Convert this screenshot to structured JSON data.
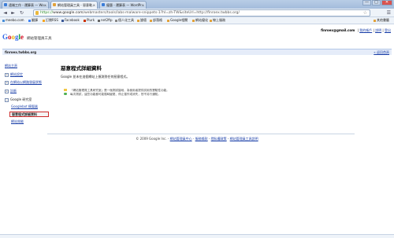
{
  "tabs": [
    {
      "label": "遠端工作 - 運算表 — Wo...",
      "active": false,
      "favicon_color": "#3b7dd8"
    },
    {
      "label": "網站管理員工具 - 惡意軟...",
      "active": true,
      "favicon_color": "#e2a23b"
    },
    {
      "label": "優惠 - 運算表 — WordPr...",
      "active": false,
      "favicon_color": "#3b7dd8"
    }
  ],
  "window": {
    "minimize": "—",
    "maximize": "□",
    "close": "✕"
  },
  "toolbar": {
    "back": "◄",
    "forward": "►",
    "reload": "↻",
    "url_scheme": "https://",
    "url_host": "www.google.com",
    "url_path": "/webmasters/tools/labs-malware-snippets-1?hl=zh-TW&siteUrl=http://finroex.twbbs.org/",
    "star": "☆",
    "menu": "☰"
  },
  "bookmarks": [
    {
      "label": "meebo.com",
      "icon_color": "#4a90d9"
    },
    {
      "label": "翻譯",
      "icon_color": "#4285f4"
    },
    {
      "label": "訂閱RSS",
      "icon_color": "#f5a623"
    },
    {
      "label": "Facebook",
      "icon_color": "#3b5998"
    },
    {
      "label": "Plurk",
      "icon_color": "#cc3300"
    },
    {
      "label": "net2ftp",
      "icon_color": "#666666"
    },
    {
      "label": "個人化工具",
      "icon_color": "#888888"
    },
    {
      "label": "論壇",
      "icon_color": "#e2a23b"
    },
    {
      "label": "部落格",
      "icon_color": "#e2a23b"
    },
    {
      "label": "Google相關",
      "icon_color": "#e2a23b"
    },
    {
      "label": "網站優化",
      "icon_color": "#e2a23b"
    },
    {
      "label": "線上服務",
      "icon_color": "#e2a23b"
    },
    {
      "label": "其他書籤",
      "icon_color": "#e2a23b"
    }
  ],
  "header": {
    "logo": [
      "G",
      "o",
      "o",
      "g",
      "l",
      "e"
    ],
    "product": "網站管理員工具",
    "email": "finroex@gmail.com",
    "sep1": "|",
    "my_account": "我的帳戶",
    "sep2": "|",
    "help": "說明",
    "sep3": "|",
    "signout": "登出"
  },
  "sitebar": {
    "site": "finroex.twbbs.org",
    "back_link": "« 返回首頁"
  },
  "sidebar": {
    "items": [
      {
        "label": "網站主頁",
        "expander": false
      },
      {
        "label": "網站設定",
        "expander": true
      },
      {
        "label": "在網站以網路發展狀態",
        "expander": true
      },
      {
        "label": "診斷",
        "expander": true
      },
      {
        "label": "Google 研究室",
        "expander": true,
        "plain": true
      },
      {
        "label": "Googlebot 模擬器",
        "expander": false,
        "indent": true
      },
      {
        "label": "惡意程式詳細資料",
        "expander": false,
        "indent": true,
        "highlight": true
      },
      {
        "label": "網站效能",
        "expander": false,
        "indent": true
      }
    ]
  },
  "main": {
    "title": "惡意程式詳細資料",
    "intro": "Google 並未在這個網站上偵測到任何惡意程式。",
    "note1": "「網站管理員工具研究室」是一個測試園地，為使用者提供試用的實驗性功能。",
    "note2": "每次測試，這些功能都可能隨時變更、停止運作或消失，恕不另行通知。"
  },
  "footer": {
    "copyright": "© 2009 Google Inc. -",
    "links": [
      "網站管理員中心",
      "服務條款",
      "隱私權政策",
      "網站管理員工具說明"
    ],
    "seps": [
      "-",
      "-",
      "-"
    ]
  }
}
